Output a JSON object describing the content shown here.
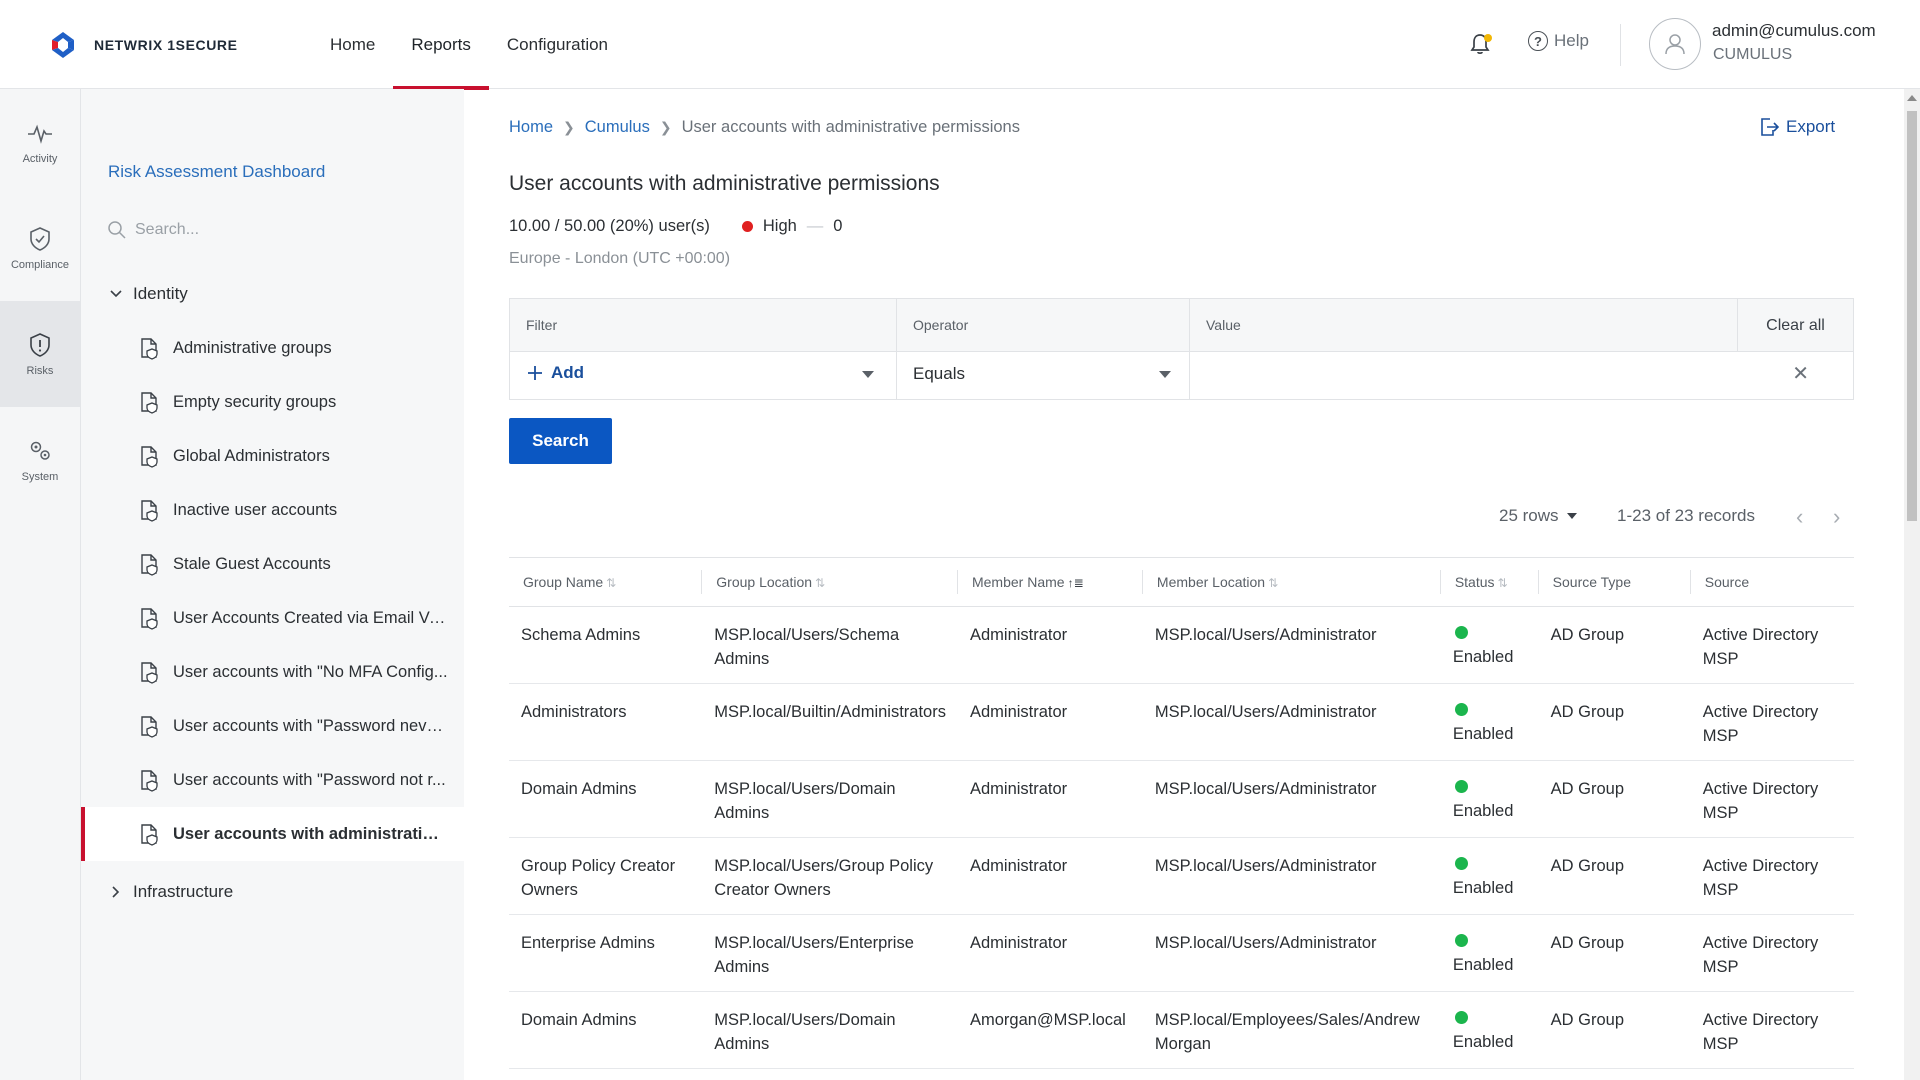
{
  "app": {
    "brand": "NETWRIX 1SECURE",
    "colors": {
      "accent": "#c8102e",
      "primary": "#0b57c2",
      "link": "#2a6ebb",
      "status_enabled": "#1bb54d",
      "risk_high": "#e02020"
    }
  },
  "topnav": {
    "items": [
      {
        "label": "Home"
      },
      {
        "label": "Reports",
        "active": true
      },
      {
        "label": "Configuration"
      }
    ]
  },
  "header": {
    "help_label": "Help",
    "user_email": "admin@cumulus.com",
    "user_org": "CUMULUS"
  },
  "rail": {
    "items": [
      {
        "label": "Activity",
        "icon": "activity-icon"
      },
      {
        "label": "Compliance",
        "icon": "shield-check-icon"
      },
      {
        "label": "Risks",
        "icon": "shield-alert-icon",
        "active": true
      },
      {
        "label": "System",
        "icon": "gears-icon"
      }
    ]
  },
  "sidebar": {
    "title": "Risk Assessment Dashboard",
    "search_placeholder": "Search...",
    "group_identity": "Identity",
    "group_infrastructure": "Infrastructure",
    "items": [
      {
        "label": "Administrative groups"
      },
      {
        "label": "Empty security groups"
      },
      {
        "label": "Global Administrators"
      },
      {
        "label": "Inactive user accounts"
      },
      {
        "label": "Stale Guest Accounts"
      },
      {
        "label": "User Accounts Created via Email Ve..."
      },
      {
        "label": "User accounts with \"No MFA Config..."
      },
      {
        "label": "User accounts with \"Password neve..."
      },
      {
        "label": "User accounts with \"Password not r..."
      },
      {
        "label": "User accounts with administrative...",
        "active": true
      }
    ]
  },
  "main": {
    "breadcrumb": [
      "Home",
      "Cumulus",
      "User accounts with administrative permissions"
    ],
    "export_label": "Export",
    "title": "User accounts with administrative permissions",
    "summary_users": "10.00 / 50.00 (20%) user(s)",
    "risk_level": "High",
    "risk_count": "0",
    "timezone": "Europe - London (UTC +00:00)",
    "filter": {
      "col_filter": "Filter",
      "col_operator": "Operator",
      "col_value": "Value",
      "clear_all": "Clear all",
      "add_label": "Add",
      "operator_value": "Equals",
      "value": ""
    },
    "search_label": "Search",
    "pager": {
      "rows": "25 rows",
      "records": "1-23 of 23 records"
    },
    "table": {
      "columns": [
        "Group Name",
        "Group Location",
        "Member Name",
        "Member Location",
        "Status",
        "Source Type",
        "Source"
      ],
      "rows": [
        {
          "group": "Schema Admins",
          "location": "MSP.local/Users/Schema Admins",
          "member": "Administrator",
          "member_location": "MSP.local/Users/Administrator",
          "status": "Enabled",
          "source_type": "AD Group",
          "source": "Active Directory MSP"
        },
        {
          "group": "Administrators",
          "location": "MSP.local/Builtin/Administrators",
          "member": "Administrator",
          "member_location": "MSP.local/Users/Administrator",
          "status": "Enabled",
          "source_type": "AD Group",
          "source": "Active Directory MSP"
        },
        {
          "group": "Domain Admins",
          "location": "MSP.local/Users/Domain Admins",
          "member": "Administrator",
          "member_location": "MSP.local/Users/Administrator",
          "status": "Enabled",
          "source_type": "AD Group",
          "source": "Active Directory MSP"
        },
        {
          "group": "Group Policy Creator Owners",
          "location": "MSP.local/Users/Group Policy Creator Owners",
          "member": "Administrator",
          "member_location": "MSP.local/Users/Administrator",
          "status": "Enabled",
          "source_type": "AD Group",
          "source": "Active Directory MSP"
        },
        {
          "group": "Enterprise Admins",
          "location": "MSP.local/Users/Enterprise Admins",
          "member": "Administrator",
          "member_location": "MSP.local/Users/Administrator",
          "status": "Enabled",
          "source_type": "AD Group",
          "source": "Active Directory MSP"
        },
        {
          "group": "Domain Admins",
          "location": "MSP.local/Users/Domain Admins",
          "member": "Amorgan@MSP.local",
          "member_location": "MSP.local/Employees/Sales/Andrew Morgan",
          "status": "Enabled",
          "source_type": "AD Group",
          "source": "Active Directory MSP"
        }
      ]
    }
  }
}
